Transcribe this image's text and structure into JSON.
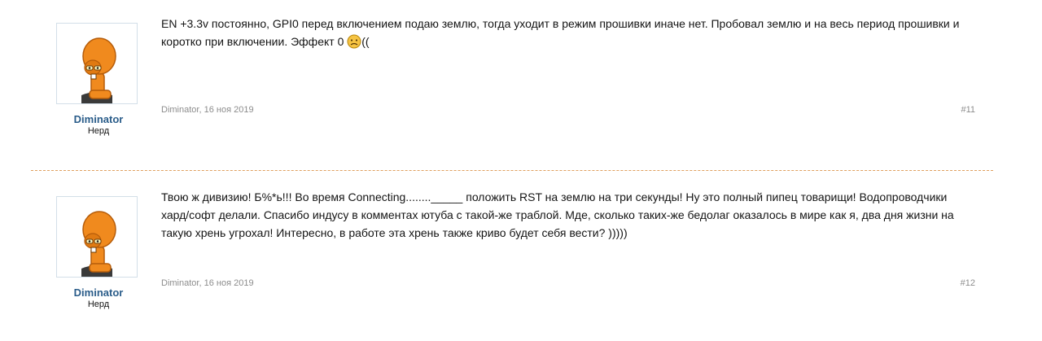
{
  "posts": [
    {
      "author": "Diminator",
      "user_title": "Нерд",
      "message_text": "EN +3.3v постоянно, GPI0 перед включением подаю землю, тогда уходит в режим прошивки иначе нет. Пробовал землю и на весь период прошивки и коротко при включении. Эффект 0 ",
      "message_tail": "((",
      "emoji_icon": "sad-face-emoji",
      "meta_author": "Diminator",
      "meta_sep": ", ",
      "meta_date": "16 ноя 2019",
      "number": "#11"
    },
    {
      "author": "Diminator",
      "user_title": "Нерд",
      "message_text": "Твою ж дивизию! Б%*ь!!! Во время Connecting........_____ положить RST на землю на три секунды! Ну это полный пипец товарищи! Водопроводчики хард/софт делали. Спасибо индусу в комментах ютуба с такой-же траблой. Мде, сколько таких-же бедолаг оказалось в мире как я, два дня жизни на такую хрень угрохал! Интересно, в работе эта хрень также криво будет себя вести? )))))",
      "meta_author": "Diminator",
      "meta_sep": ", ",
      "meta_date": "16 ноя 2019",
      "number": "#12"
    }
  ],
  "colors": {
    "username": "#2b5d8a",
    "avatar_orange": "#f08a1e",
    "divider": "#e0a060",
    "meta_text": "#8c8c8c"
  }
}
